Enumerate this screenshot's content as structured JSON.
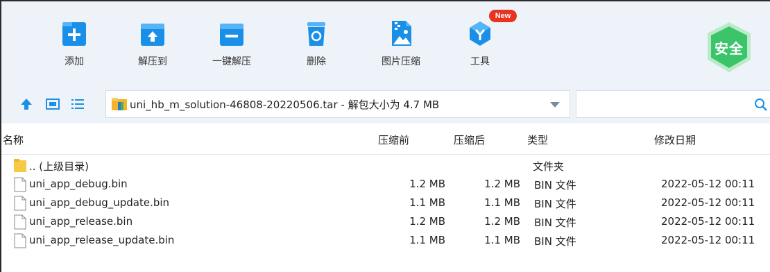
{
  "toolbar": {
    "items": [
      {
        "label": "添加",
        "icon": "add-icon"
      },
      {
        "label": "解压到",
        "icon": "extract-to-icon"
      },
      {
        "label": "一键解压",
        "icon": "quick-extract-icon"
      },
      {
        "label": "删除",
        "icon": "delete-icon"
      },
      {
        "label": "图片压缩",
        "icon": "image-compress-icon"
      },
      {
        "label": "工具",
        "icon": "tools-icon"
      }
    ],
    "new_badge": "New",
    "safe_badge": "安全"
  },
  "addressbar": {
    "path": "uni_hb_m_solution-46808-20220506.tar - 解包大小为 4.7 MB",
    "search_placeholder": ""
  },
  "list": {
    "columns": [
      "名称",
      "压缩前",
      "压缩后",
      "类型",
      "修改日期"
    ],
    "parent": {
      "name": ".. (上级目录)",
      "type": "文件夹"
    },
    "rows": [
      {
        "name": "uni_app_debug.bin",
        "before": "1.2 MB",
        "after": "1.2 MB",
        "type": "BIN 文件",
        "date": "2022-05-12 00:11"
      },
      {
        "name": "uni_app_debug_update.bin",
        "before": "1.1 MB",
        "after": "1.1 MB",
        "type": "BIN 文件",
        "date": "2022-05-12 00:11"
      },
      {
        "name": "uni_app_release.bin",
        "before": "1.2 MB",
        "after": "1.2 MB",
        "type": "BIN 文件",
        "date": "2022-05-12 00:11"
      },
      {
        "name": "uni_app_release_update.bin",
        "before": "1.1 MB",
        "after": "1.1 MB",
        "type": "BIN 文件",
        "date": "2022-05-12 00:11"
      }
    ]
  },
  "colors": {
    "accent": "#1a8fe8",
    "safe": "#3cc46a",
    "new_badge": "#e8331f"
  }
}
